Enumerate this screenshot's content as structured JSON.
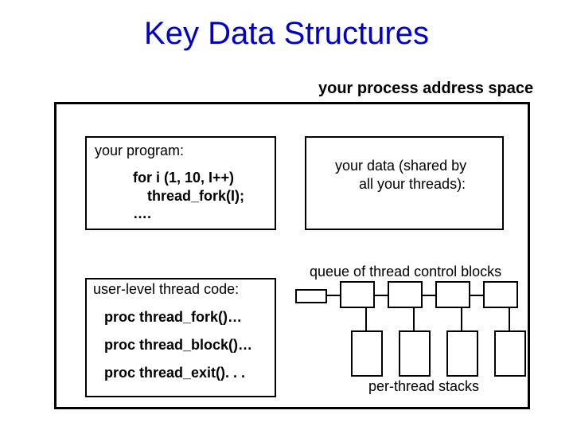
{
  "title": "Key Data Structures",
  "outer_label": "your process address space",
  "program": {
    "label": "your program:",
    "line1": "for i (1, 10, I++)",
    "line2": "thread_fork(I);",
    "line3": "…."
  },
  "data_box": {
    "line1": "your data (shared by",
    "line2": "all your threads):"
  },
  "thread_code": {
    "label": "user-level thread code:",
    "proc1": "proc thread_fork()…",
    "proc2": "proc thread_block()…",
    "proc3": "proc thread_exit(). . ."
  },
  "queue_label": "queue of thread control blocks",
  "stacks_label": "per-thread stacks"
}
